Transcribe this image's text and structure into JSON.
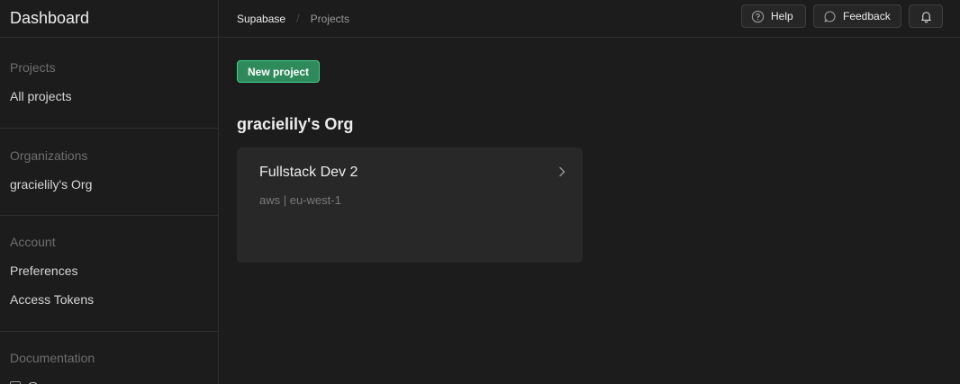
{
  "sidebar": {
    "title": "Dashboard",
    "sections": {
      "projects": {
        "heading": "Projects",
        "items": [
          "All projects"
        ]
      },
      "organizations": {
        "heading": "Organizations",
        "items": [
          "gracielily's Org"
        ]
      },
      "account": {
        "heading": "Account",
        "items": [
          "Preferences",
          "Access Tokens"
        ]
      },
      "documentation": {
        "heading": "Documentation",
        "items": [
          "@..."
        ]
      }
    }
  },
  "header": {
    "breadcrumb": {
      "root": "Supabase",
      "separator": "/",
      "current": "Projects"
    },
    "help_label": "Help",
    "feedback_label": "Feedback"
  },
  "main": {
    "new_project_label": "New project",
    "org_name": "gracielily's Org",
    "projects": [
      {
        "name": "Fullstack Dev 2",
        "subtitle": "aws | eu-west-1"
      }
    ]
  },
  "colors": {
    "background": "#1c1c1c",
    "accent": "#3ecf8e",
    "button_green": "#2f8a5b",
    "card": "#282828"
  },
  "icons": {
    "help": "help-circle-icon",
    "feedback": "message-icon",
    "notifications": "bell-icon",
    "chevron": "chevron-right-icon"
  }
}
